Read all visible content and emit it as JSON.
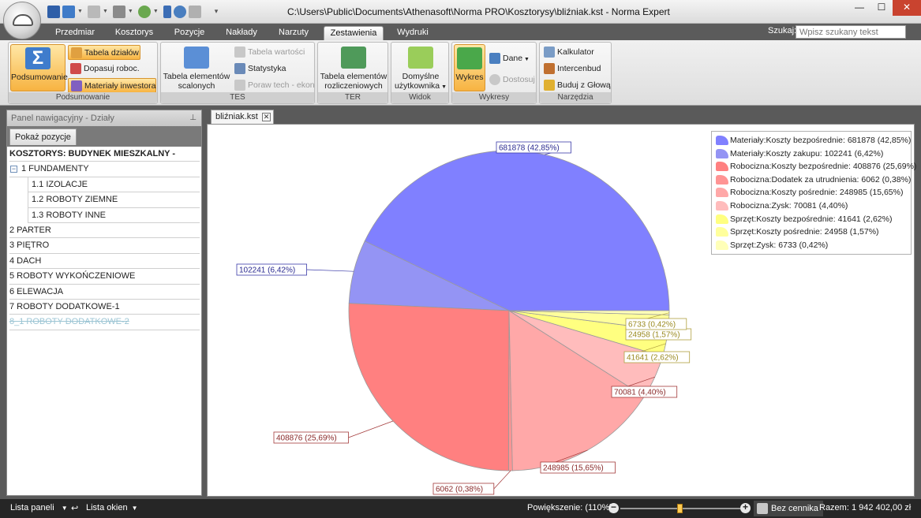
{
  "window": {
    "title": "C:\\Users\\Public\\Documents\\Athenasoft\\Norma PRO\\Kosztorysy\\bliźniak.kst - Norma Expert",
    "minimize": "—",
    "maximize": "☐",
    "close": "✕"
  },
  "ribbon_tabs": [
    "Przedmiar",
    "Kosztorys",
    "Pozycje",
    "Nakłady",
    "Narzuty",
    "Zestawienia",
    "Wydruki"
  ],
  "active_tab": "Zestawienia",
  "search": {
    "label": "Szukaj:",
    "placeholder": "Wpisz szukany tekst"
  },
  "groups": {
    "podsumowanie": {
      "label": "Podsumowanie",
      "big_button": "Podsumowanie",
      "items": [
        "Tabela działów",
        "Dopasuj roboc.",
        "Materiały inwestora"
      ]
    },
    "tes": {
      "label": "TES",
      "big_button_line1": "Tabela elementów",
      "big_button_line2": "scalonych",
      "items": [
        "Tabela wartości",
        "Statystyka",
        "Poraw tech - ekon"
      ]
    },
    "ter": {
      "label": "TER",
      "big_button_line1": "Tabela elementów",
      "big_button_line2": "rozliczeniowych"
    },
    "widok": {
      "label": "Widok",
      "big_button_line1": "Domyślne",
      "big_button_line2": "użytkownika"
    },
    "wykresy": {
      "label": "Wykresy",
      "big_button": "Wykres",
      "items": [
        "Dane",
        "Dostosuj"
      ]
    },
    "narzedzia": {
      "label": "Narzędzia",
      "items": [
        "Kalkulator",
        "Intercenbud",
        "Buduj z Głową"
      ]
    }
  },
  "side_panel": {
    "title": "Panel nawigacyjny - Działy",
    "show_positions": "Pokaż pozycje",
    "root": "KOSZTORYS: BUDYNEK  MIESZKALNY -",
    "items": [
      {
        "label": "1 FUNDAMENTY",
        "level": 1,
        "expanded": true
      },
      {
        "label": "1.1 IZOLACJE",
        "level": 2
      },
      {
        "label": "1.2 ROBOTY ZIEMNE",
        "level": 2
      },
      {
        "label": "1.3 ROBOTY INNE",
        "level": 2
      },
      {
        "label": "2 PARTER",
        "level": 1
      },
      {
        "label": "3 PIĘTRO",
        "level": 1
      },
      {
        "label": "4 DACH",
        "level": 1
      },
      {
        "label": "5 ROBOTY  WYKOŃCZENIOWE",
        "level": 1
      },
      {
        "label": "6 ELEWACJA",
        "level": 1
      },
      {
        "label": "7 ROBOTY DODATKOWE-1",
        "level": 1
      },
      {
        "label": "8_1 ROBOTY DODATKOWE-2",
        "level": 1,
        "struck": true
      }
    ]
  },
  "document_tab": {
    "label": "bliźniak.kst",
    "close": "✕"
  },
  "chart_data": {
    "type": "pie",
    "legend_position": "top-right",
    "slices": [
      {
        "label": "Materiały:Koszty bezpośrednie",
        "value": 681878,
        "percent": "42,85%",
        "color": "#8080ff",
        "stroke": "#3a3aa8",
        "text_color": "#2a2a90"
      },
      {
        "label": "Materiały:Koszty zakupu",
        "value": 102241,
        "percent": "6,42%",
        "color": "#9494f4",
        "stroke": "#3a3aa8",
        "text_color": "#2a2a90"
      },
      {
        "label": "Robocizna:Koszty bezpośrednie",
        "value": 408876,
        "percent": "25,69%",
        "color": "#ff8080",
        "stroke": "#a33a3a",
        "text_color": "#8a2a2a"
      },
      {
        "label": "Robocizna:Dodatek za utrudnienia",
        "value": 6062,
        "percent": "0,38%",
        "color": "#ff9494",
        "stroke": "#a33a3a",
        "text_color": "#8a2a2a"
      },
      {
        "label": "Robocizna:Koszty pośrednie",
        "value": 248985,
        "percent": "15,65%",
        "color": "#ffa8a8",
        "stroke": "#a33a3a",
        "text_color": "#8a2a2a"
      },
      {
        "label": "Robocizna:Zysk",
        "value": 70081,
        "percent": "4,40%",
        "color": "#ffbcbc",
        "stroke": "#a33a3a",
        "text_color": "#8a2a2a"
      },
      {
        "label": "Sprzęt:Koszty bezpośrednie",
        "value": 41641,
        "percent": "2,62%",
        "color": "#ffff80",
        "stroke": "#b0a040",
        "text_color": "#9a8a20"
      },
      {
        "label": "Sprzęt:Koszty pośrednie",
        "value": 24958,
        "percent": "1,57%",
        "color": "#ffff9c",
        "stroke": "#b0a040",
        "text_color": "#9a8a20"
      },
      {
        "label": "Sprzęt:Zysk",
        "value": 6733,
        "percent": "0,42%",
        "color": "#ffffb8",
        "stroke": "#b0a040",
        "text_color": "#9a8a20"
      }
    ]
  },
  "statusbar": {
    "panels": "Lista paneli",
    "windows": "Lista okien",
    "zoom_label": "Powiększenie: (110%)",
    "zoom_value": 0.5,
    "price_list": "Bez cennika",
    "total": "Razem: 1 942 402,00 zł"
  }
}
